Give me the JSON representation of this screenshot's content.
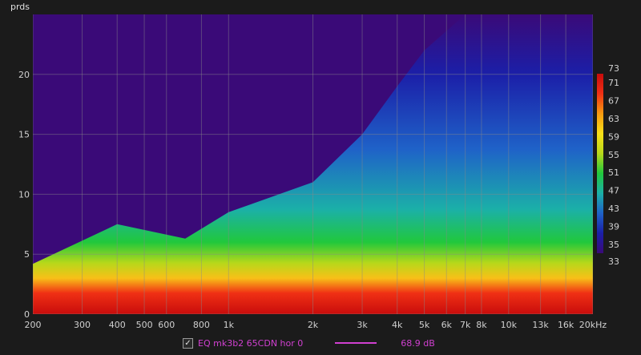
{
  "chart_data": {
    "type": "heatmap",
    "ylabel": "prds",
    "x_ticks": [
      "200",
      "300",
      "400",
      "500",
      "600",
      "800",
      "1k",
      "2k",
      "3k",
      "4k",
      "5k",
      "6k",
      "7k",
      "8k",
      "10k",
      "13k",
      "16k",
      "20kHz"
    ],
    "x_tick_values": [
      200,
      300,
      400,
      500,
      600,
      800,
      1000,
      2000,
      3000,
      4000,
      5000,
      6000,
      7000,
      8000,
      10000,
      13000,
      16000,
      20000
    ],
    "x_range": [
      200,
      20000
    ],
    "x_scale": "log",
    "y_ticks": [
      0,
      5,
      10,
      15,
      20
    ],
    "y_range": [
      0,
      25
    ],
    "colorbar_ticks": [
      73,
      71,
      67,
      63,
      59,
      55,
      51,
      47,
      43,
      39,
      35,
      33
    ],
    "colorbar_range": [
      33,
      73
    ],
    "colors": [
      "#3a0a78",
      "#1b1fa8",
      "#1f62c8",
      "#1bb0a8",
      "#21c83c",
      "#b8d81a",
      "#f8e018",
      "#f89a10",
      "#f03014",
      "#c80c0c"
    ],
    "grid": true,
    "decay_envelope": [
      [
        200,
        4.2
      ],
      [
        400,
        7.5
      ],
      [
        700,
        6.3
      ],
      [
        1000,
        8.5
      ],
      [
        2000,
        11
      ],
      [
        3000,
        15
      ],
      [
        4000,
        19
      ],
      [
        5000,
        22
      ],
      [
        7000,
        25
      ],
      [
        20000,
        25
      ]
    ],
    "series": [
      {
        "name": "EQ mk3b2 65CDN hor 0",
        "level": "68.9 dB"
      }
    ]
  },
  "legend": {
    "checked_mark": "✓",
    "name": "EQ mk3b2 65CDN hor 0",
    "value": "68.9 dB"
  }
}
